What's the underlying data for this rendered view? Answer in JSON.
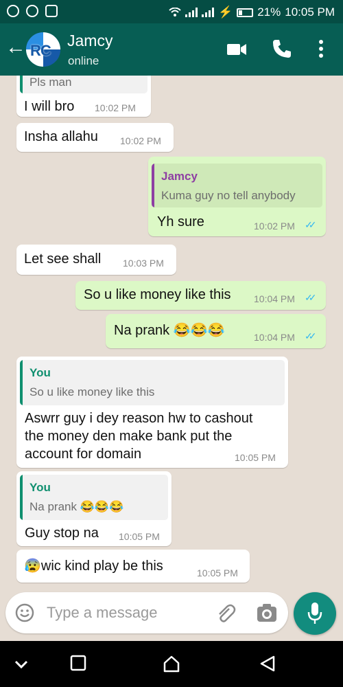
{
  "status_bar": {
    "battery": "21%",
    "time": "10:05 PM"
  },
  "header": {
    "back_icon": "arrow-left-icon",
    "avatar_text": "RC",
    "name": "Jamcy",
    "status": "online"
  },
  "messages": [
    {
      "dir": "in",
      "quote_text": "Pls man",
      "text": "I will bro",
      "time": "10:02 PM"
    },
    {
      "dir": "in",
      "text": "Insha allahu",
      "time": "10:02 PM"
    },
    {
      "dir": "out",
      "quote_name": "Jamcy",
      "quote_text": "Kuma guy no tell anybody",
      "text": "Yh sure",
      "time": "10:02 PM",
      "read": true
    },
    {
      "dir": "in",
      "text": "Let see shall",
      "time": "10:03 PM"
    },
    {
      "dir": "out",
      "text": "So u like money like this",
      "time": "10:04 PM",
      "read": true
    },
    {
      "dir": "out",
      "text": "Na prank 😂😂😂",
      "time": "10:04 PM",
      "read": true
    },
    {
      "dir": "in",
      "quote_name": "You",
      "quote_text": "So u like money like this",
      "lines": [
        "Aswrr guy i dey reason hw to cashout",
        "the money den make bank put the",
        "account for domain"
      ],
      "time": "10:05 PM"
    },
    {
      "dir": "in",
      "quote_name": "You",
      "quote_text": "Na prank 😂😂😂",
      "text": "Guy stop na",
      "time": "10:05 PM"
    },
    {
      "dir": "in",
      "text": "😰wic kind play be this",
      "time": "10:05 PM"
    }
  ],
  "composer": {
    "placeholder": "Type a message"
  },
  "colors": {
    "header": "#075e54",
    "statusbar": "#054d44",
    "outgoing": "#dcf8c6",
    "incoming": "#ffffff",
    "quote_accent": "#0f8f6f",
    "quote_name_jamcy": "#8e3ea3",
    "ticks": "#34b7f1"
  }
}
